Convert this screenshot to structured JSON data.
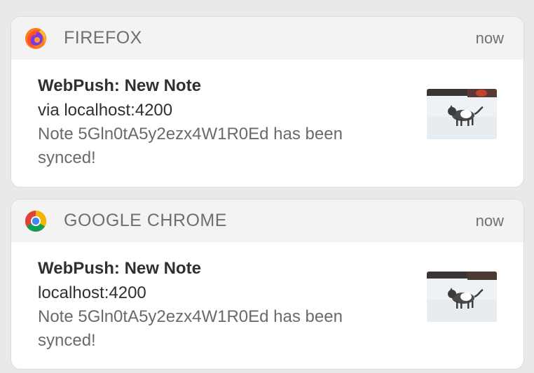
{
  "notifications": [
    {
      "app": "FIREFOX",
      "app_icon": "firefox-icon",
      "time": "now",
      "title": "WebPush: New Note",
      "subtitle": "via localhost:4200",
      "message": "Note 5Gln0tA5y2ezx4W1R0Ed has been synced!",
      "image": "cat-in-snow-thumbnail"
    },
    {
      "app": "GOOGLE CHROME",
      "app_icon": "chrome-icon",
      "time": "now",
      "title": "WebPush: New Note",
      "subtitle": "localhost:4200",
      "message": "Note 5Gln0tA5y2ezx4W1R0Ed has been synced!",
      "image": "cat-in-snow-thumbnail"
    }
  ],
  "colors": {
    "background": "#e9e9e9",
    "card": "#ffffff",
    "header": "#f3f3f3",
    "title_text": "#303030",
    "secondary_text": "#6a6a6a"
  }
}
